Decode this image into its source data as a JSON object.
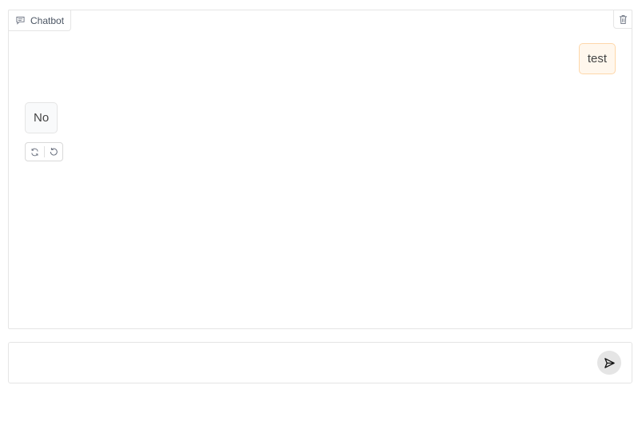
{
  "chatbot": {
    "label": "Chatbot",
    "label_icon": "chat-bubble-icon",
    "clear_icon": "trash-icon"
  },
  "messages": [
    {
      "role": "user",
      "text": "test"
    },
    {
      "role": "bot",
      "text": "No"
    }
  ],
  "message_actions": {
    "retry_icon": "refresh-icon",
    "undo_icon": "undo-icon"
  },
  "input": {
    "value": "",
    "placeholder": "",
    "send_icon": "send-icon"
  },
  "colors": {
    "user_bubble_bg": "#fff7ed",
    "user_bubble_border": "#fed7aa",
    "bot_bubble_bg": "#f9fafb",
    "border": "#e5e5e5"
  }
}
